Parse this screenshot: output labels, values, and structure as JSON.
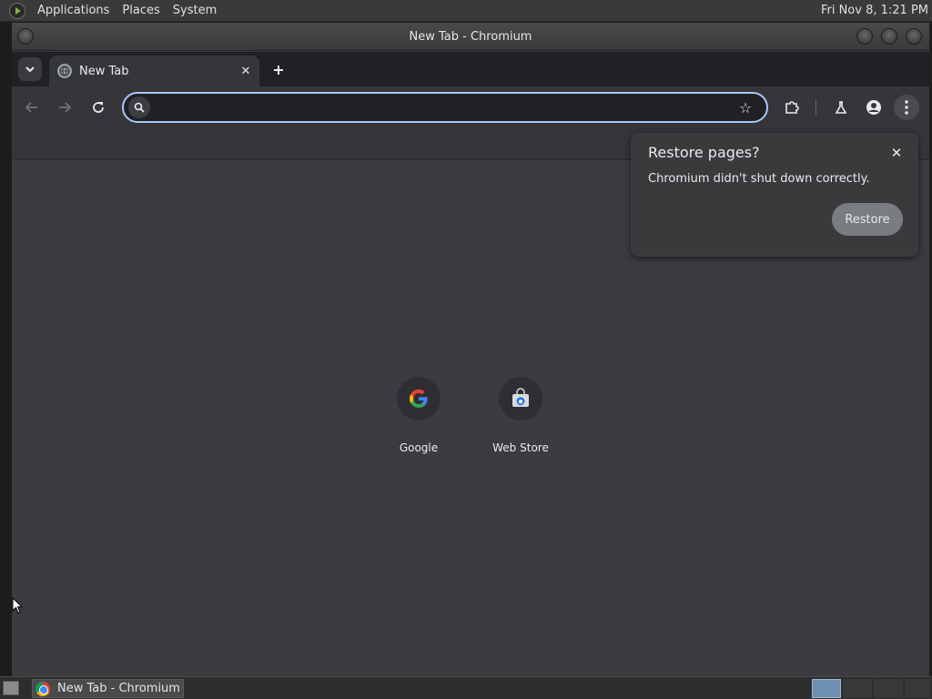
{
  "top_panel": {
    "menus": [
      "Applications",
      "Places",
      "System"
    ],
    "clock": "Fri Nov  8,  1:21 PM"
  },
  "window": {
    "title": "New Tab - Chromium"
  },
  "tabs": [
    {
      "label": "New Tab",
      "favicon": "globe-icon",
      "active": true
    }
  ],
  "omnibox": {
    "value": "",
    "placeholder": ""
  },
  "restore_bubble": {
    "title": "Restore pages?",
    "message": "Chromium didn't shut down correctly.",
    "button_label": "Restore"
  },
  "shortcuts": [
    {
      "label": "Google",
      "icon": "google-g-icon"
    },
    {
      "label": "Web Store",
      "icon": "web-store-icon"
    }
  ],
  "taskbar": {
    "task_label": "New Tab - Chromium",
    "task_icon": "chromium-icon"
  },
  "colors": {
    "accent": "#a8c7fa",
    "content_bg": "#3c3c40",
    "toolbar_bg": "#35363a",
    "tabstrip_bg": "#202124"
  }
}
